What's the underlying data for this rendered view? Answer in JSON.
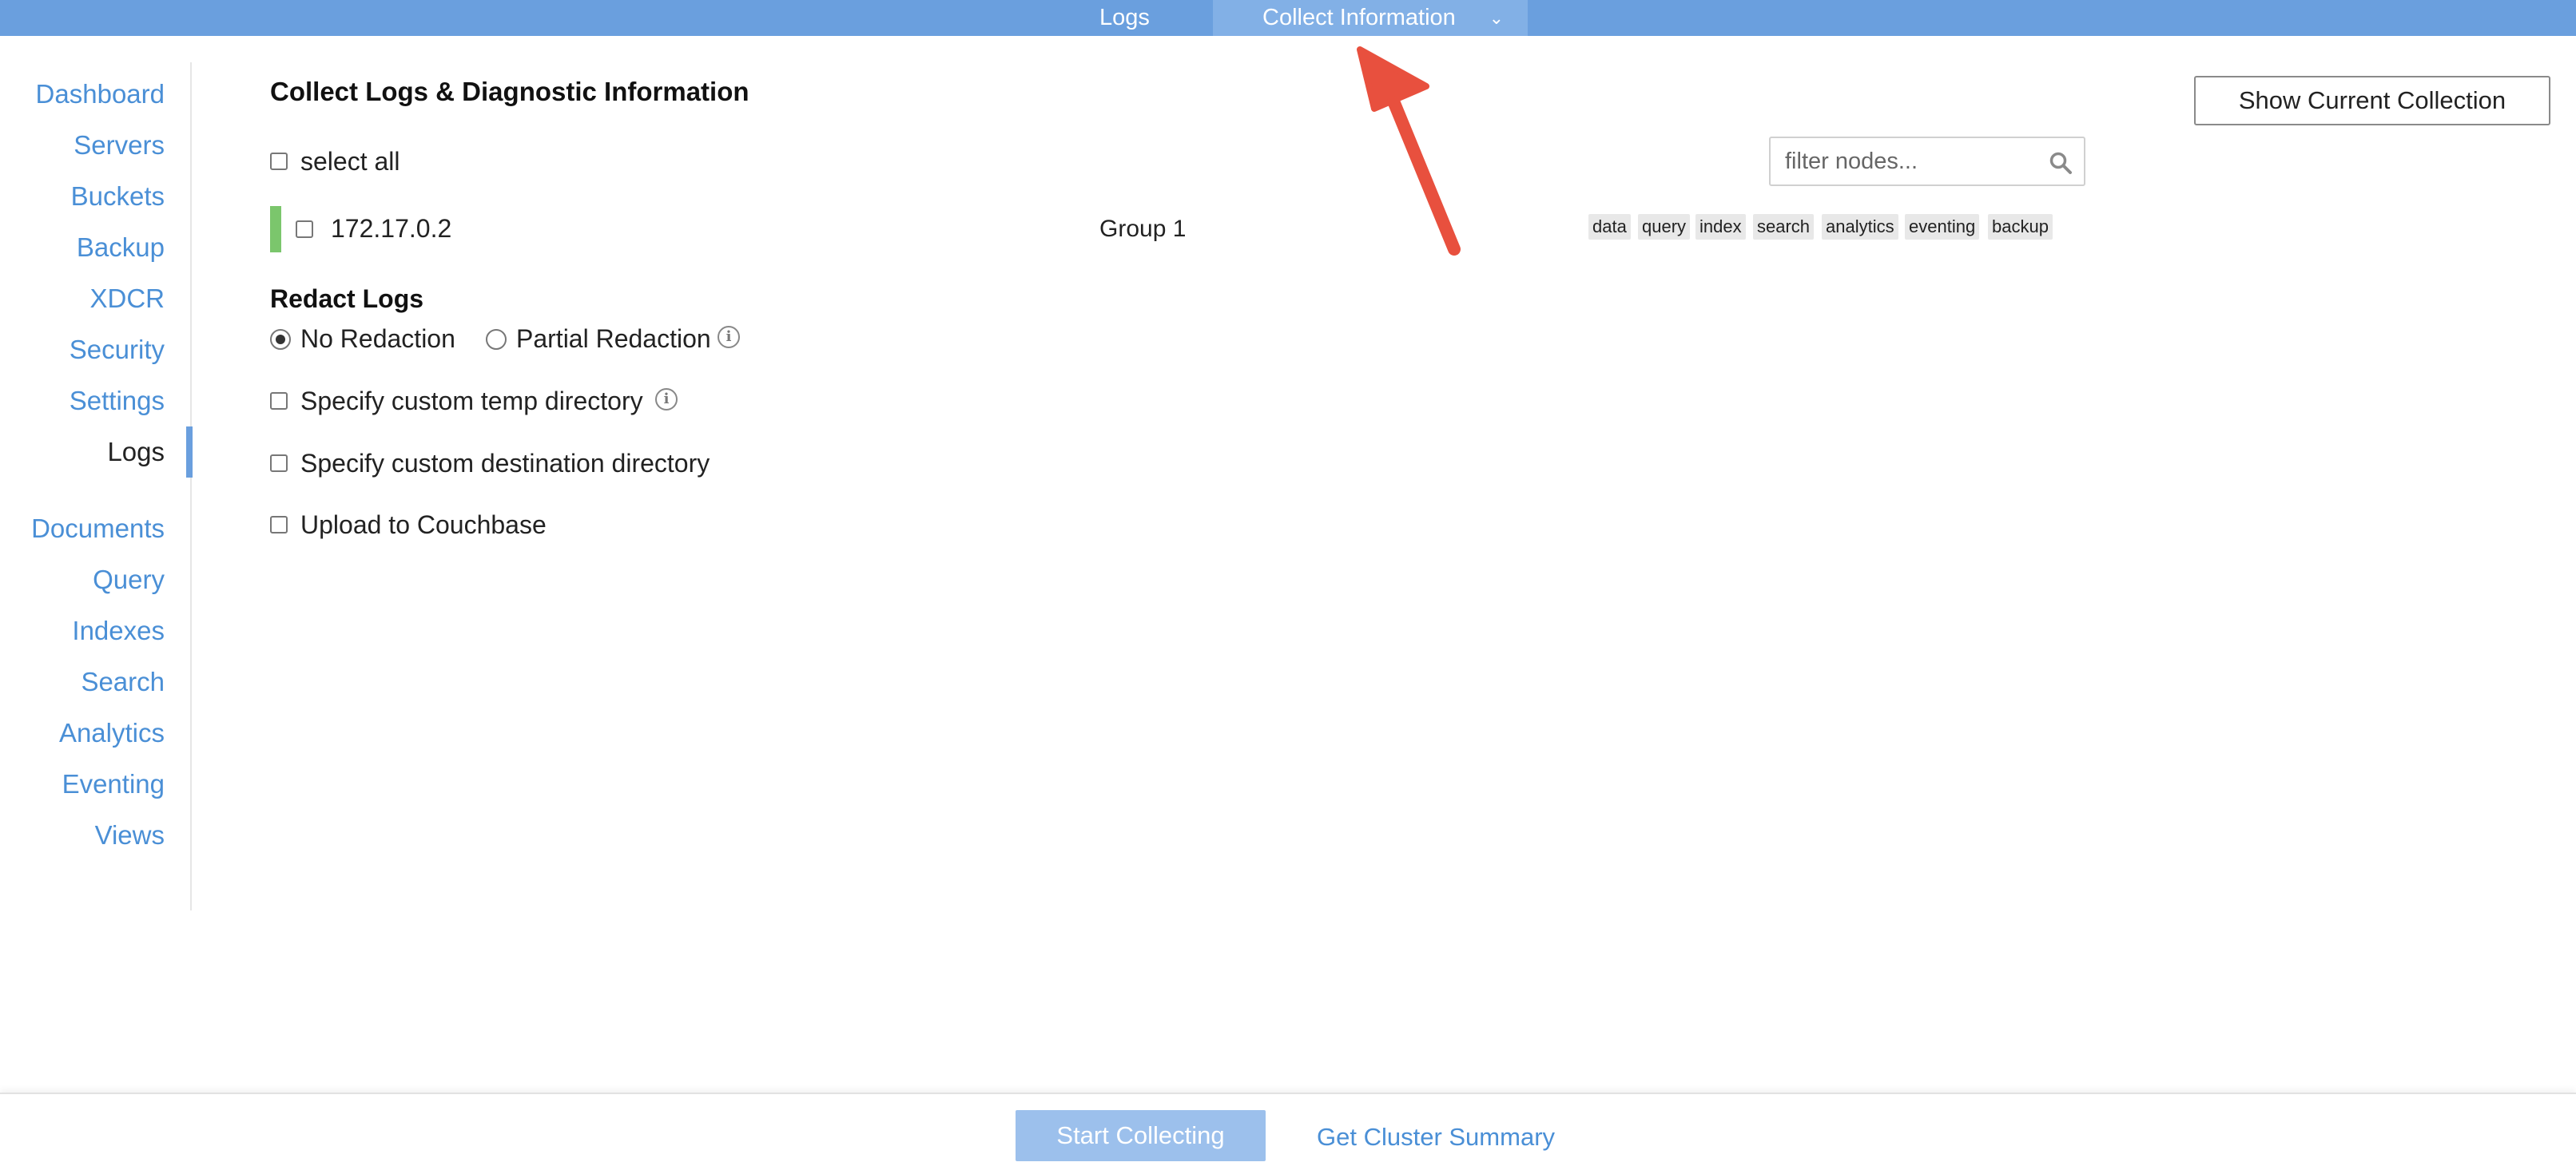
{
  "topbar": {
    "tab_logs": "Logs",
    "tab_collect": "Collect Information",
    "accent": "#6a9fde"
  },
  "sidebar": {
    "items": [
      {
        "label": "Dashboard"
      },
      {
        "label": "Servers"
      },
      {
        "label": "Buckets"
      },
      {
        "label": "Backup"
      },
      {
        "label": "XDCR"
      },
      {
        "label": "Security"
      },
      {
        "label": "Settings"
      },
      {
        "label": "Logs"
      },
      {
        "label": "Documents"
      },
      {
        "label": "Query"
      },
      {
        "label": "Indexes"
      },
      {
        "label": "Search"
      },
      {
        "label": "Analytics"
      },
      {
        "label": "Eventing"
      },
      {
        "label": "Views"
      }
    ],
    "active": "Logs"
  },
  "main": {
    "title": "Collect Logs & Diagnostic Information",
    "select_all_label": "select all",
    "filter_placeholder": "filter nodes...",
    "show_collection_label": "Show Current Collection",
    "node": {
      "ip": "172.17.0.2",
      "group": "Group 1",
      "status_color": "#7bc66c",
      "services": [
        "data",
        "query",
        "index",
        "search",
        "analytics",
        "eventing",
        "backup"
      ]
    },
    "redact": {
      "title": "Redact Logs",
      "no_redaction": "No Redaction",
      "partial_redaction": "Partial Redaction",
      "selected": "No Redaction"
    },
    "options": {
      "temp_dir": "Specify custom temp directory",
      "dest_dir": "Specify custom destination directory",
      "upload": "Upload to Couchbase"
    }
  },
  "footer": {
    "start_label": "Start Collecting",
    "summary_label": "Get Cluster Summary"
  }
}
